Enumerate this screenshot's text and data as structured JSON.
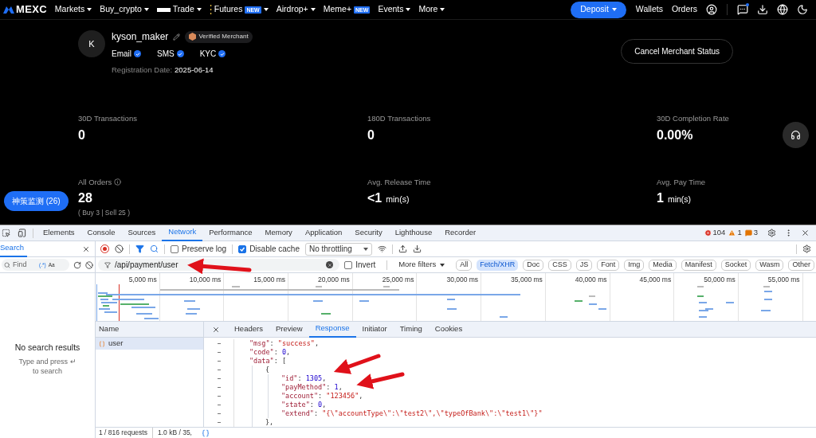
{
  "nav": {
    "logo": "MEXC",
    "items": [
      {
        "label": "Markets",
        "kind": "plain",
        "caret": true
      },
      {
        "label": "Buy_crypto",
        "kind": "plain",
        "caret": true
      },
      {
        "label": "Trade",
        "kind": "bar",
        "caret": true
      },
      {
        "label": "Futures",
        "kind": "dots",
        "badge": "NEW",
        "caret": true
      },
      {
        "label": "Airdrop+",
        "kind": "plain",
        "caret": true
      },
      {
        "label": "Meme+",
        "kind": "plain",
        "badge": "NEW",
        "caret": false
      },
      {
        "label": "Events",
        "kind": "plain",
        "caret": true
      },
      {
        "label": "More",
        "kind": "plain",
        "caret": true
      }
    ],
    "deposit": "Deposit",
    "links": [
      "Wallets",
      "Orders"
    ]
  },
  "profile": {
    "avatar": "K",
    "username": "kyson_maker",
    "badge": "Verified Merchant",
    "verifications": [
      {
        "label": "Email",
        "verified": true
      },
      {
        "label": "SMS",
        "verified": true
      },
      {
        "label": "KYC",
        "verified": true
      }
    ],
    "registration_label": "Registration Date:",
    "registration_date": "2025-06-14",
    "cancel_button": "Cancel Merchant Status"
  },
  "stats": [
    {
      "label": "30D Transactions",
      "value": "0"
    },
    {
      "label": "180D Transactions",
      "value": "0"
    },
    {
      "label": "30D Completion Rate",
      "value": "0.00%"
    },
    {
      "label": "All Orders",
      "value": "28",
      "info": true,
      "sub": "( Buy 3 | Sell 25 )"
    },
    {
      "label": "Avg. Release Time",
      "value": "<1",
      "unit": "min(s)"
    },
    {
      "label": "Avg. Pay Time",
      "value": "1",
      "unit": "min(s)"
    }
  ],
  "float_button": "神策监测 (26)",
  "devtools": {
    "tabs": [
      {
        "label": "Elements",
        "selected": false
      },
      {
        "label": "Console",
        "selected": false
      },
      {
        "label": "Sources",
        "selected": false
      },
      {
        "label": "Network",
        "selected": true
      },
      {
        "label": "Performance",
        "selected": false
      },
      {
        "label": "Memory",
        "selected": false
      },
      {
        "label": "Application",
        "selected": false
      },
      {
        "label": "Security",
        "selected": false
      },
      {
        "label": "Lighthouse",
        "selected": false
      },
      {
        "label": "Recorder",
        "selected": false
      }
    ],
    "counts": {
      "errors": "104",
      "warnings": "1",
      "issues": "3"
    },
    "sidebar": {
      "tab": "Search",
      "find_placeholder": "Find",
      "regex": "(.*)",
      "match_case": "Aa",
      "empty_title": "No search results",
      "empty_hint": "Type and press ↵ to search"
    },
    "toolbar": {
      "preserve_log": {
        "label": "Preserve log",
        "checked": false
      },
      "disable_cache": {
        "label": "Disable cache",
        "checked": true
      },
      "throttling": "No throttling"
    },
    "filter": {
      "value": "/api/payment/user",
      "invert": {
        "label": "Invert",
        "checked": false
      },
      "more_filters": "More filters",
      "chips": [
        {
          "label": "All",
          "selected": false
        },
        {
          "label": "Fetch/XHR",
          "selected": true
        },
        {
          "label": "Doc",
          "selected": false
        },
        {
          "label": "CSS",
          "selected": false
        },
        {
          "label": "JS",
          "selected": false
        },
        {
          "label": "Font",
          "selected": false
        },
        {
          "label": "Img",
          "selected": false
        },
        {
          "label": "Media",
          "selected": false
        },
        {
          "label": "Manifest",
          "selected": false
        },
        {
          "label": "Socket",
          "selected": false
        },
        {
          "label": "Wasm",
          "selected": false
        },
        {
          "label": "Other",
          "selected": false
        }
      ]
    },
    "overview_ticks": [
      "5,000 ms",
      "10,000 ms",
      "15,000 ms",
      "20,000 ms",
      "25,000 ms",
      "30,000 ms",
      "35,000 ms",
      "40,000 ms",
      "45,000 ms",
      "50,000 ms",
      "55,000 ms"
    ],
    "requests": {
      "column": "Name",
      "rows": [
        {
          "name": "user",
          "selected": true
        }
      ]
    },
    "detail_tabs": [
      {
        "label": "Headers",
        "selected": false
      },
      {
        "label": "Preview",
        "selected": false
      },
      {
        "label": "Response",
        "selected": true
      },
      {
        "label": "Initiator",
        "selected": false
      },
      {
        "label": "Timing",
        "selected": false
      },
      {
        "label": "Cookies",
        "selected": false
      }
    ],
    "response": [
      {
        "text": "\"msg\": \"success\","
      },
      {
        "text": "\"code\": 0,"
      },
      {
        "text": "\"data\": [",
        "children": [
          {
            "text": "{",
            "children": [
              {
                "text": "\"id\": 1305,"
              },
              {
                "text": "\"payMethod\": 1,"
              },
              {
                "text": "\"account\": \"123456\","
              },
              {
                "text": "\"state\": 0,"
              },
              {
                "text": "\"extend\": \"{\\\"accountType\\\":\\\"test2\\\",\\\"typeOfBank\\\":\\\"test1\\\"}\""
              }
            ]
          },
          {
            "text": "},"
          }
        ]
      }
    ],
    "status": {
      "requests": "1 / 816 requests",
      "size": "1.0 kB / 35,"
    }
  }
}
